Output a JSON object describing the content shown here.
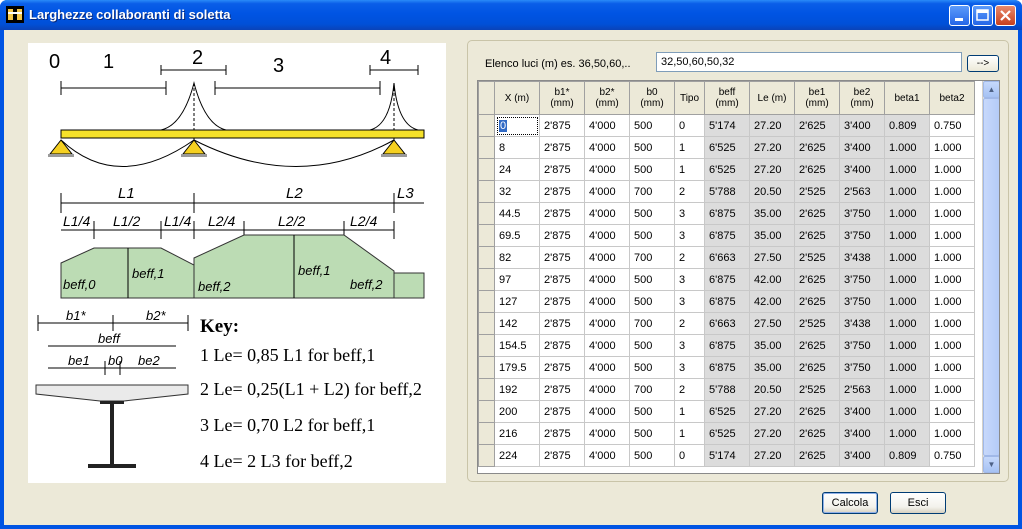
{
  "window": {
    "title": "Larghezze collaboranti di soletta"
  },
  "diagram": {
    "support_labels": [
      "0",
      "1",
      "2",
      "3",
      "4"
    ],
    "spans": [
      "L1",
      "L2",
      "L3"
    ],
    "fractions": [
      "L1/4",
      "L1/2",
      "L1/4",
      "L2/4",
      "L2/2",
      "L2/4"
    ],
    "beff_labels": [
      "beff,0",
      "beff,1",
      "beff,2",
      "beff,1",
      "beff,2"
    ],
    "section_labels": [
      "b1*",
      "b2*",
      "beff",
      "be1",
      "b0",
      "be2"
    ],
    "key_title": "Key:",
    "key_items": [
      "1 Le= 0,85 L1 for beff,1",
      "2 Le= 0,25(L1 + L2) for beff,2",
      "3 Le= 0,70 L2 for beff,1",
      "4 Le= 2 L3 for beff,2"
    ]
  },
  "elenco": {
    "label": "Elenco luci (m) es. 36,50,60,..",
    "value": "32,50,60,50,32",
    "button": "-->"
  },
  "grid": {
    "columns": [
      [
        "X (m)"
      ],
      [
        "b1*",
        "(mm)"
      ],
      [
        "b2*",
        "(mm)"
      ],
      [
        "b0",
        "(mm)"
      ],
      [
        "Tipo"
      ],
      [
        "beff",
        "(mm)"
      ],
      [
        "Le (m)"
      ],
      [
        "be1",
        "(mm)"
      ],
      [
        "be2",
        "(mm)"
      ],
      [
        "beta1"
      ],
      [
        "beta2"
      ]
    ],
    "rows": [
      [
        "0",
        "2'875",
        "4'000",
        "500",
        "0",
        "5'174",
        "27.20",
        "2'625",
        "3'400",
        "0.809",
        "0.750"
      ],
      [
        "8",
        "2'875",
        "4'000",
        "500",
        "1",
        "6'525",
        "27.20",
        "2'625",
        "3'400",
        "1.000",
        "1.000"
      ],
      [
        "24",
        "2'875",
        "4'000",
        "500",
        "1",
        "6'525",
        "27.20",
        "2'625",
        "3'400",
        "1.000",
        "1.000"
      ],
      [
        "32",
        "2'875",
        "4'000",
        "700",
        "2",
        "5'788",
        "20.50",
        "2'525",
        "2'563",
        "1.000",
        "1.000"
      ],
      [
        "44.5",
        "2'875",
        "4'000",
        "500",
        "3",
        "6'875",
        "35.00",
        "2'625",
        "3'750",
        "1.000",
        "1.000"
      ],
      [
        "69.5",
        "2'875",
        "4'000",
        "500",
        "3",
        "6'875",
        "35.00",
        "2'625",
        "3'750",
        "1.000",
        "1.000"
      ],
      [
        "82",
        "2'875",
        "4'000",
        "700",
        "2",
        "6'663",
        "27.50",
        "2'525",
        "3'438",
        "1.000",
        "1.000"
      ],
      [
        "97",
        "2'875",
        "4'000",
        "500",
        "3",
        "6'875",
        "42.00",
        "2'625",
        "3'750",
        "1.000",
        "1.000"
      ],
      [
        "127",
        "2'875",
        "4'000",
        "500",
        "3",
        "6'875",
        "42.00",
        "2'625",
        "3'750",
        "1.000",
        "1.000"
      ],
      [
        "142",
        "2'875",
        "4'000",
        "700",
        "2",
        "6'663",
        "27.50",
        "2'525",
        "3'438",
        "1.000",
        "1.000"
      ],
      [
        "154.5",
        "2'875",
        "4'000",
        "500",
        "3",
        "6'875",
        "35.00",
        "2'625",
        "3'750",
        "1.000",
        "1.000"
      ],
      [
        "179.5",
        "2'875",
        "4'000",
        "500",
        "3",
        "6'875",
        "35.00",
        "2'625",
        "3'750",
        "1.000",
        "1.000"
      ],
      [
        "192",
        "2'875",
        "4'000",
        "700",
        "2",
        "5'788",
        "20.50",
        "2'525",
        "2'563",
        "1.000",
        "1.000"
      ],
      [
        "200",
        "2'875",
        "4'000",
        "500",
        "1",
        "6'525",
        "27.20",
        "2'625",
        "3'400",
        "1.000",
        "1.000"
      ],
      [
        "216",
        "2'875",
        "4'000",
        "500",
        "1",
        "6'525",
        "27.20",
        "2'625",
        "3'400",
        "1.000",
        "1.000"
      ],
      [
        "224",
        "2'875",
        "4'000",
        "500",
        "0",
        "5'174",
        "27.20",
        "2'625",
        "3'400",
        "0.809",
        "0.750"
      ]
    ]
  },
  "buttons": {
    "calcola": "Calcola",
    "esci": "Esci"
  }
}
